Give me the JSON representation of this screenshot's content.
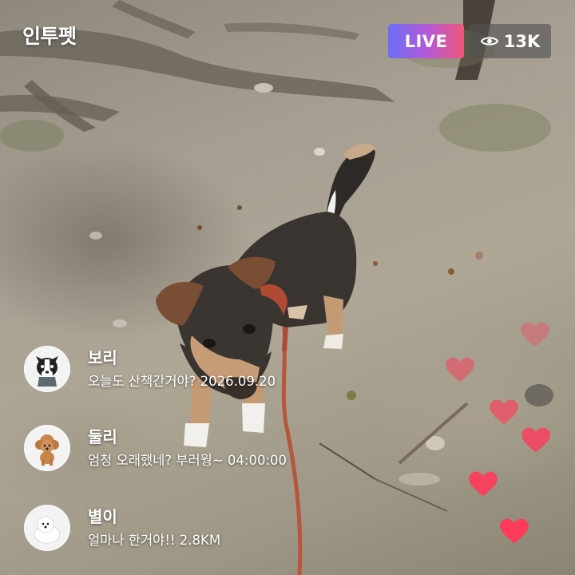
{
  "app": {
    "logo_text": "인투펫"
  },
  "live": {
    "label": "LIVE",
    "accent_start": "#6c6ef5",
    "accent_end": "#f0557d"
  },
  "viewers": {
    "count": "13K",
    "icon": "eye-icon"
  },
  "chat": [
    {
      "name": "보리",
      "message": "오늘도 산책간거야? 2026.09.20",
      "avatar": "border-collie-avatar"
    },
    {
      "name": "둘리",
      "message": "엄청 오래했네? 부러웡~ 04:00:00",
      "avatar": "poodle-avatar"
    },
    {
      "name": "별이",
      "message": "얼마나 한거야!! 2.8KM",
      "avatar": "white-dog-avatar"
    }
  ],
  "reactions": {
    "icon": "heart-icon",
    "color": "#ff3b5c"
  }
}
